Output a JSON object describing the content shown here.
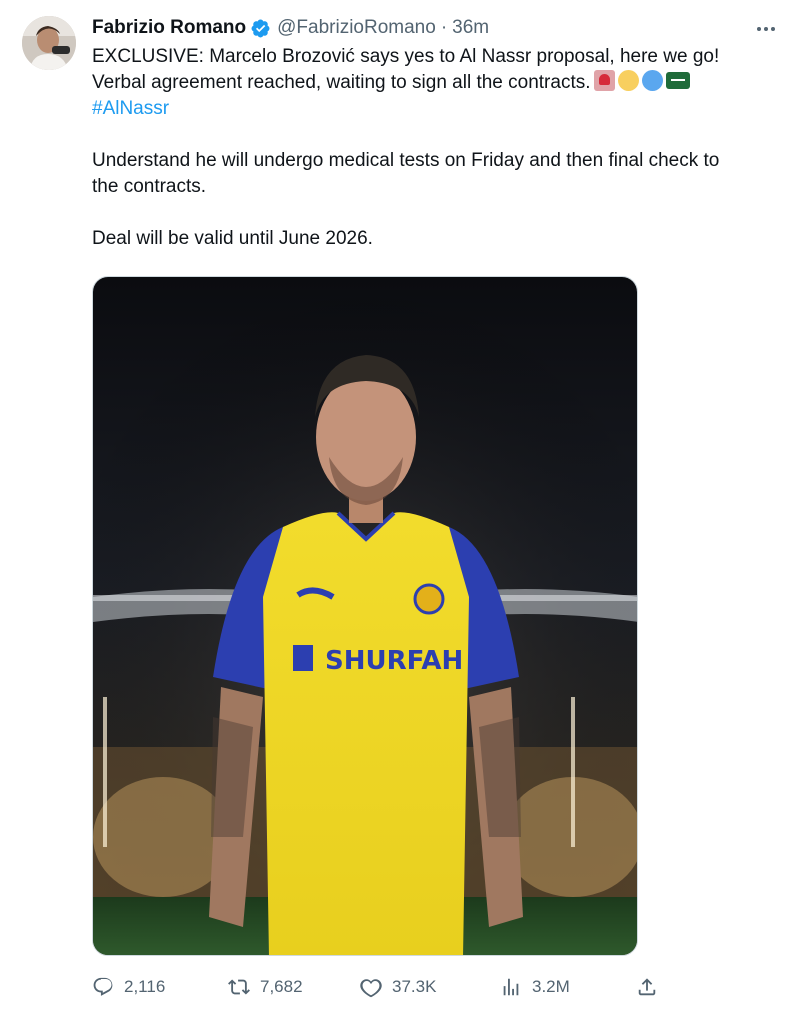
{
  "tweet": {
    "author": {
      "display_name": "Fabrizio Romano",
      "handle": "@FabrizioRomano",
      "verified": true,
      "avatar_icon": "avatar-photo"
    },
    "separator": "·",
    "time": "36m",
    "text": {
      "line1": "EXCLUSIVE: Marcelo Brozović says yes to Al Nassr proposal, here we go!",
      "line2": "Verbal agreement reached, waiting to sign all the contracts.",
      "line2_emojis": [
        "rotating-light-emoji",
        "yellow-circle-emoji",
        "blue-circle-emoji",
        "saudi-arabia-flag-emoji"
      ],
      "hashtag": "#AlNassr",
      "para2_line1": "Understand he will undergo medical tests on Friday and then final check to",
      "para2_line2": "the contracts.",
      "para3": "Deal will be valid until June 2026."
    },
    "media": {
      "jersey_sponsor": "SHURFAH",
      "description_icon": "player-photo"
    },
    "actions": {
      "replies": "2,116",
      "retweets": "7,682",
      "likes": "37.3K",
      "views": "3.2M"
    },
    "colors": {
      "text": "#0f1419",
      "secondary": "#536471",
      "link": "#1d9bf0",
      "verified": "#1d9bf0"
    }
  }
}
